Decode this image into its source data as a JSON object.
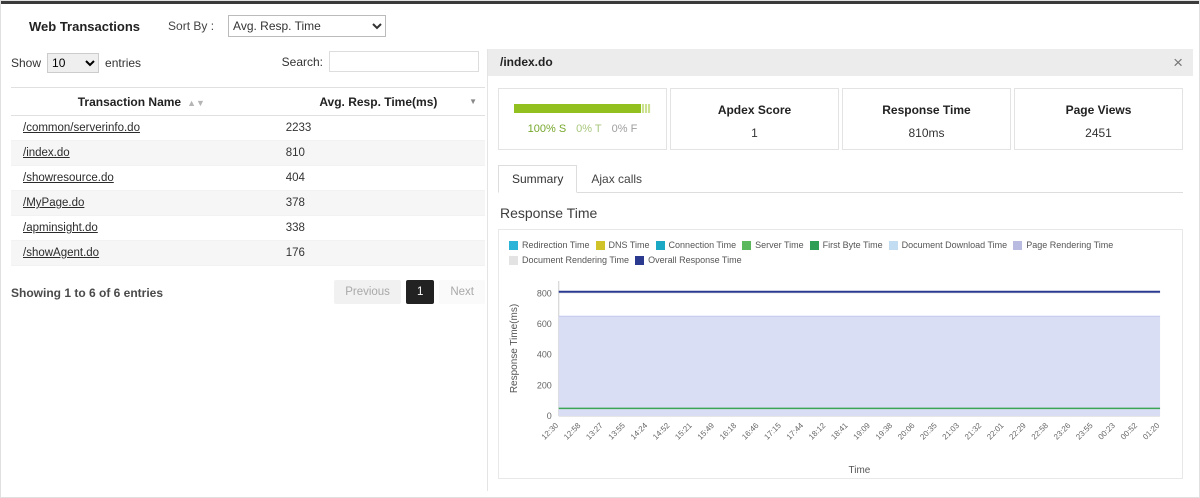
{
  "header": {
    "title": "Web Transactions",
    "sort_by_label": "Sort By :",
    "sort_by_value": "Avg. Resp. Time"
  },
  "table_panel": {
    "show_label": "Show",
    "show_value": "10",
    "entries_label": "entries",
    "search_label": "Search:",
    "search_value": "",
    "columns": [
      "Transaction Name",
      "Avg. Resp. Time(ms)"
    ],
    "rows": [
      {
        "name": "/common/serverinfo.do",
        "value": "2233"
      },
      {
        "name": "/index.do",
        "value": "810"
      },
      {
        "name": "/showresource.do",
        "value": "404"
      },
      {
        "name": "/MyPage.do",
        "value": "378"
      },
      {
        "name": "/apminsight.do",
        "value": "338"
      },
      {
        "name": "/showAgent.do",
        "value": "176"
      }
    ],
    "footer_text": "Showing 1 to 6 of 6 entries",
    "pagination": {
      "previous": "Previous",
      "page": "1",
      "next": "Next"
    }
  },
  "detail_panel": {
    "title": "/index.do",
    "close_icon": "×",
    "apdex": {
      "satisfied_label": "100% S",
      "tolerating_label": "0% T",
      "frustrated_label": "0% F",
      "bar_color": "#92c01f",
      "bar_tip_color": "#cbe18f",
      "satisfied_color": "#76a72b",
      "tolerating_color": "#a9c77d",
      "frustrated_color": "#9e9e9e"
    },
    "cards": [
      {
        "title": "Apdex Score",
        "value": "1"
      },
      {
        "title": "Response Time",
        "value": "810ms"
      },
      {
        "title": "Page Views",
        "value": "2451"
      }
    ],
    "tabs": [
      {
        "label": "Summary"
      },
      {
        "label": "Ajax calls"
      }
    ],
    "section_title": "Response Time"
  },
  "chart_data": {
    "type": "area",
    "title": "Response Time",
    "xlabel": "Time",
    "ylabel": "Response Time(ms)",
    "ylim": [
      0,
      880
    ],
    "yticks": [
      0,
      200,
      400,
      600,
      800
    ],
    "grid": true,
    "legend_position": "top",
    "x": [
      "12:30",
      "12:58",
      "13:27",
      "13:55",
      "14:24",
      "14:52",
      "15:21",
      "15:49",
      "16:18",
      "16:46",
      "17:15",
      "17:44",
      "18:12",
      "18:41",
      "19:09",
      "19:38",
      "20:06",
      "20:35",
      "21:03",
      "21:32",
      "22:01",
      "22:29",
      "22:58",
      "23:26",
      "23:55",
      "00:23",
      "00:52",
      "01:20"
    ],
    "legend": [
      {
        "name": "Redirection Time",
        "color": "#2bb3d8"
      },
      {
        "name": "DNS Time",
        "color": "#cfc329"
      },
      {
        "name": "Connection Time",
        "color": "#1ba8c4"
      },
      {
        "name": "Server Time",
        "color": "#5cb85c"
      },
      {
        "name": "First Byte Time",
        "color": "#2e9e54"
      },
      {
        "name": "Document Download Time",
        "color": "#c2ddf2"
      },
      {
        "name": "Page Rendering Time",
        "color": "#b9bce0"
      },
      {
        "name": "Document Rendering Time",
        "color": "#e3e3e3"
      },
      {
        "name": "Overall Response Time",
        "color": "#2b3a8f"
      }
    ],
    "series": [
      {
        "name": "Page Rendering Time",
        "type": "area",
        "color": "#c3c9ef",
        "fill": "#dadef5",
        "values": [
          650,
          650,
          650,
          650,
          650,
          650,
          650,
          650,
          650,
          650,
          650,
          650,
          650,
          650,
          650,
          650,
          650,
          650,
          650,
          650,
          650,
          650,
          650,
          650,
          650,
          650,
          650,
          650
        ]
      },
      {
        "name": "First Byte Time",
        "type": "line",
        "color": "#3aa655",
        "width": 1.5,
        "values": [
          50,
          50,
          50,
          50,
          50,
          50,
          50,
          50,
          50,
          50,
          50,
          50,
          50,
          50,
          50,
          50,
          50,
          50,
          50,
          50,
          50,
          50,
          50,
          50,
          50,
          50,
          50,
          50
        ]
      },
      {
        "name": "Overall Response Time",
        "type": "line",
        "color": "#2b3a8f",
        "width": 2,
        "values": [
          810,
          810,
          810,
          810,
          810,
          810,
          810,
          810,
          810,
          810,
          810,
          810,
          810,
          810,
          810,
          810,
          810,
          810,
          810,
          810,
          810,
          810,
          810,
          810,
          810,
          810,
          810,
          810
        ]
      }
    ]
  }
}
